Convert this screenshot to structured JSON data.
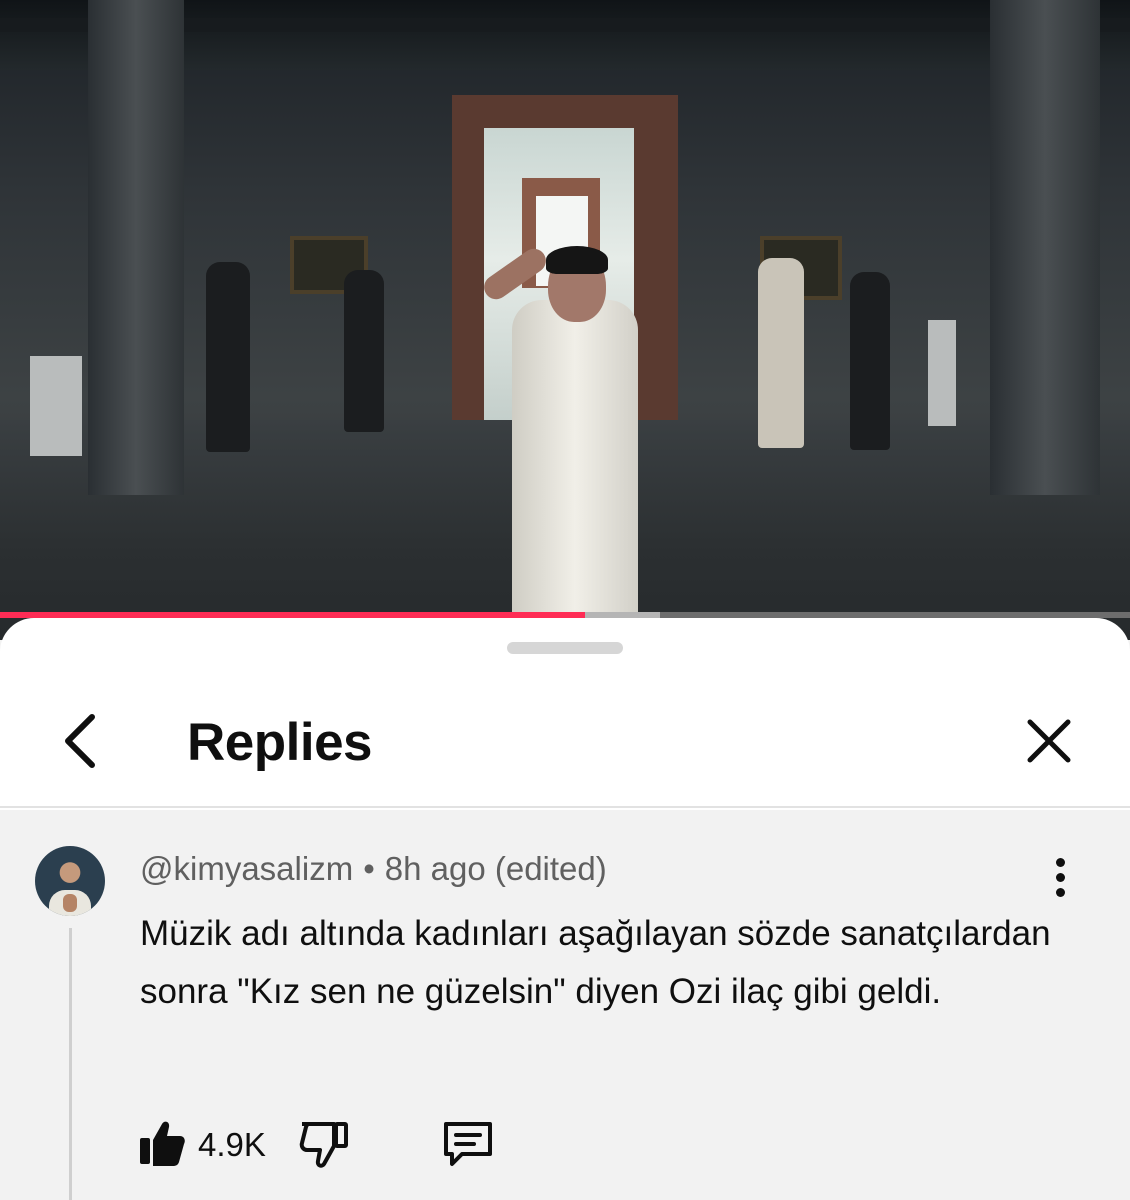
{
  "video": {
    "progress": {
      "played_fraction": 0.518,
      "buffered_fraction": 0.584
    }
  },
  "replies_panel": {
    "title": "Replies"
  },
  "comment": {
    "author": "@kimyasalizm",
    "separator": "•",
    "time": "8h ago (edited)",
    "text": "Müzik adı altında kadınları aşağılayan sözde sanatçılardan sonra \"Kız sen ne güzelsin\" diyen Ozi ilaç gibi geldi.",
    "like_count": "4.9K"
  },
  "icons": {
    "back": "chevron-left-icon",
    "close": "close-icon",
    "more": "more-vert-icon",
    "like": "thumb-up-icon",
    "dislike": "thumb-down-icon",
    "reply": "comment-icon"
  },
  "colors": {
    "progress_played": "#ff2c55",
    "text_primary": "#0f0f0f",
    "text_secondary": "#606060"
  }
}
